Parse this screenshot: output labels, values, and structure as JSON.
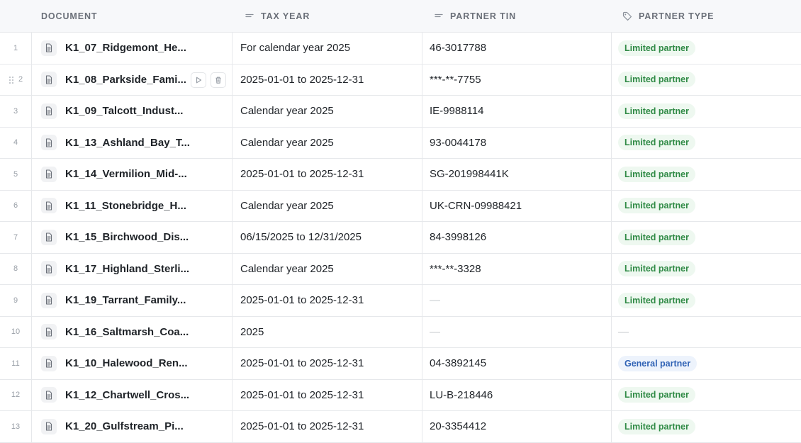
{
  "columns": {
    "document": "DOCUMENT",
    "tax_year": "TAX YEAR",
    "partner_tin": "PARTNER TIN",
    "partner_type": "PARTNER TYPE"
  },
  "icons": {
    "tax_year": "text-lines-icon",
    "partner_tin": "text-lines-icon",
    "partner_type": "tag-icon",
    "document": "document-icon",
    "run": "play-icon",
    "delete": "trash-icon",
    "drag": "drag-handle-icon"
  },
  "rows": [
    {
      "num": "1",
      "document": "K1_07_Ridgemont_He...",
      "tax_year": "For calendar year 2025",
      "partner_tin": "46-3017788",
      "partner_type": "Limited partner",
      "type_kind": "lp"
    },
    {
      "num": "2",
      "document": "K1_08_Parkside_Fami...",
      "tax_year": "2025-01-01 to 2025-12-31",
      "partner_tin": "***-**-7755",
      "partner_type": "Limited partner",
      "type_kind": "lp",
      "hovered": true
    },
    {
      "num": "3",
      "document": "K1_09_Talcott_Indust...",
      "tax_year": "Calendar year 2025",
      "partner_tin": "IE-9988114",
      "partner_type": "Limited partner",
      "type_kind": "lp"
    },
    {
      "num": "4",
      "document": "K1_13_Ashland_Bay_T...",
      "tax_year": "Calendar year 2025",
      "partner_tin": "93-0044178",
      "partner_type": "Limited partner",
      "type_kind": "lp"
    },
    {
      "num": "5",
      "document": "K1_14_Vermilion_Mid-...",
      "tax_year": "2025-01-01 to 2025-12-31",
      "partner_tin": "SG-201998441K",
      "partner_type": "Limited partner",
      "type_kind": "lp"
    },
    {
      "num": "6",
      "document": "K1_11_Stonebridge_H...",
      "tax_year": "Calendar year 2025",
      "partner_tin": "UK-CRN-09988421",
      "partner_type": "Limited partner",
      "type_kind": "lp"
    },
    {
      "num": "7",
      "document": "K1_15_Birchwood_Dis...",
      "tax_year": "06/15/2025 to 12/31/2025",
      "partner_tin": "84-3998126",
      "partner_type": "Limited partner",
      "type_kind": "lp"
    },
    {
      "num": "8",
      "document": "K1_17_Highland_Sterli...",
      "tax_year": "Calendar year 2025",
      "partner_tin": "***-**-3328",
      "partner_type": "Limited partner",
      "type_kind": "lp"
    },
    {
      "num": "9",
      "document": "K1_19_Tarrant_Family...",
      "tax_year": "2025-01-01 to 2025-12-31",
      "partner_tin": "—",
      "partner_type": "Limited partner",
      "type_kind": "lp"
    },
    {
      "num": "10",
      "document": "K1_16_Saltmarsh_Coa...",
      "tax_year": "2025",
      "partner_tin": "—",
      "partner_type": "—",
      "type_kind": "none"
    },
    {
      "num": "11",
      "document": "K1_10_Halewood_Ren...",
      "tax_year": "2025-01-01 to 2025-12-31",
      "partner_tin": "04-3892145",
      "partner_type": "General partner",
      "type_kind": "gp"
    },
    {
      "num": "12",
      "document": "K1_12_Chartwell_Cros...",
      "tax_year": "2025-01-01 to 2025-12-31",
      "partner_tin": "LU-B-218446",
      "partner_type": "Limited partner",
      "type_kind": "lp"
    },
    {
      "num": "13",
      "document": "K1_20_Gulfstream_Pi...",
      "tax_year": "2025-01-01 to 2025-12-31",
      "partner_tin": "20-3354412",
      "partner_type": "Limited partner",
      "type_kind": "lp"
    }
  ]
}
